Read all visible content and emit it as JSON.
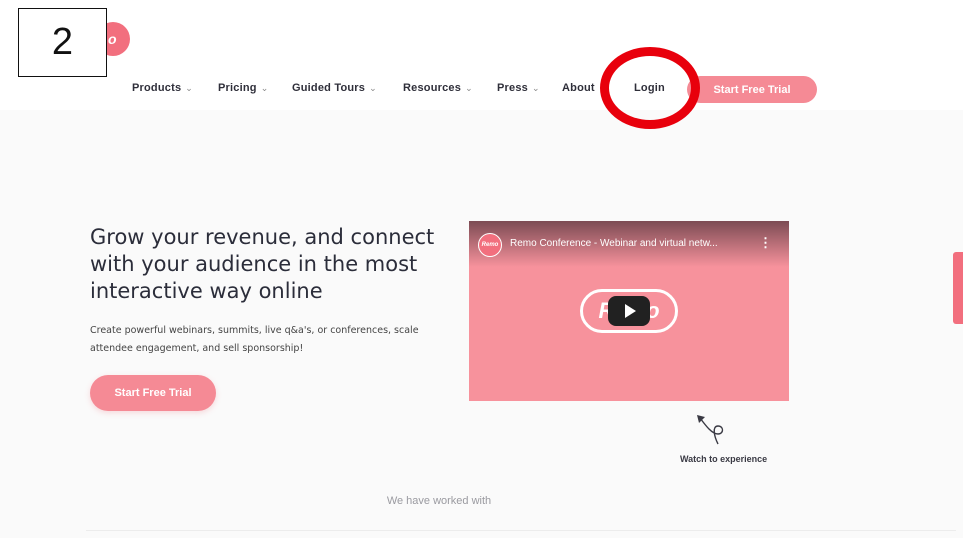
{
  "step_marker": {
    "label": "2"
  },
  "logo": {
    "text": "o"
  },
  "nav": {
    "items": [
      {
        "label": "Products",
        "chevron": "⌄"
      },
      {
        "label": "Pricing",
        "chevron": "⌄"
      },
      {
        "label": "Guided Tours",
        "chevron": "⌄"
      },
      {
        "label": "Resources",
        "chevron": "⌄"
      },
      {
        "label": "Press",
        "chevron": "⌄"
      },
      {
        "label": "About",
        "chevron": ""
      },
      {
        "label": "Login",
        "chevron": ""
      }
    ],
    "cta_label": "Start Free Trial"
  },
  "hero": {
    "title": "Grow your revenue, and connect with your audience in the most interactive way online",
    "subtitle": "Create powerful webinars, summits, live q&a's, or conferences, scale attendee engagement, and sell sponsorship!",
    "cta_label": "Start Free Trial"
  },
  "video": {
    "avatar_text": "Remo",
    "title": "Remo Conference - Webinar and virtual netw...",
    "menu_glyph": "⋮",
    "pill_text": "Remo"
  },
  "watch_label": "Watch to experience",
  "worked_with": "We have worked with",
  "colors": {
    "brand": "#f26f7e",
    "button": "#f58a95",
    "highlight": "#e8000c"
  }
}
